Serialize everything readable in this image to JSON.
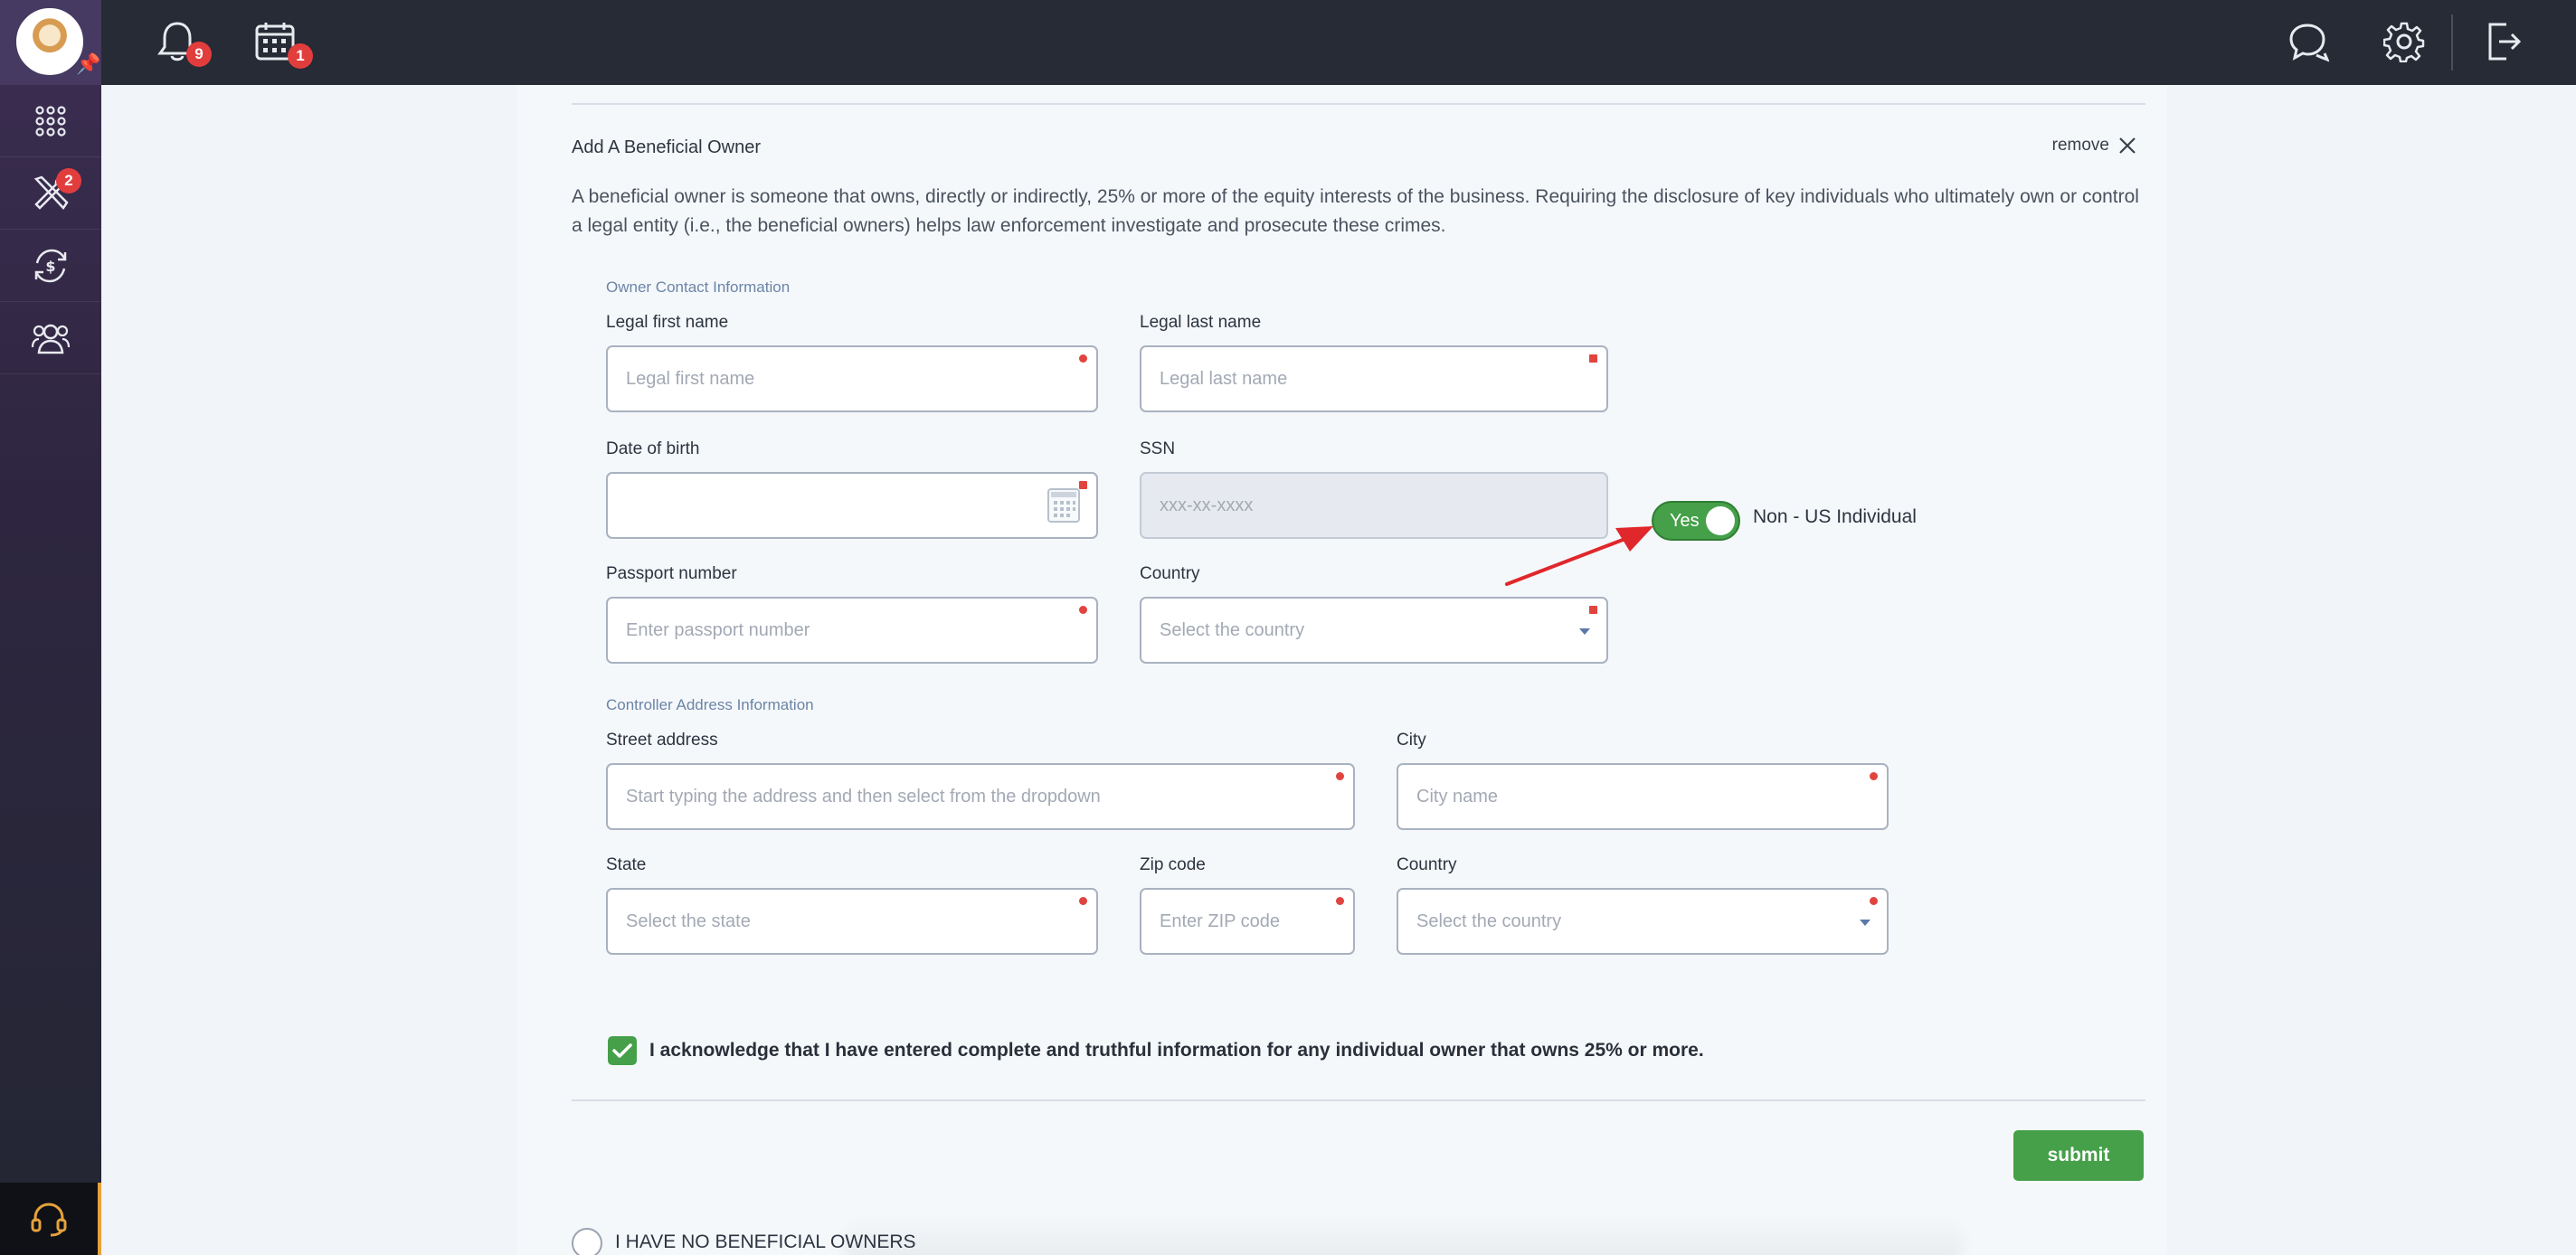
{
  "topbar": {
    "notifications_count": "9",
    "calendar_count": "1"
  },
  "sidebar": {
    "tools_badge": "2"
  },
  "form": {
    "section_title": "Add A Beneficial Owner",
    "remove_label": "remove",
    "description": "A beneficial owner is someone that owns, directly or indirectly, 25% or more of the equity interests of the business. Requiring the disclosure of key individuals who ultimately own or control a legal entity (i.e., the beneficial owners) helps law enforcement investigate and prosecute these crimes.",
    "contact_group": "Owner Contact Information",
    "first_name": {
      "label": "Legal first name",
      "placeholder": "Legal first name",
      "value": ""
    },
    "last_name": {
      "label": "Legal last name",
      "placeholder": "Legal last name",
      "value": ""
    },
    "dob": {
      "label": "Date of birth",
      "value": ""
    },
    "ssn": {
      "label": "SSN",
      "placeholder": "xxx-xx-xxxx"
    },
    "non_us_toggle": {
      "state_label": "Yes",
      "label": "Non - US Individual",
      "on": true
    },
    "passport": {
      "label": "Passport number",
      "placeholder": "Enter passport number"
    },
    "country": {
      "label": "Country",
      "placeholder": "Select the country"
    },
    "address_group": "Controller Address Information",
    "street": {
      "label": "Street address",
      "placeholder": "Start typing the address and then select from the dropdown"
    },
    "city": {
      "label": "City",
      "placeholder": "City name"
    },
    "state": {
      "label": "State",
      "placeholder": "Select the state"
    },
    "zip": {
      "label": "Zip code",
      "placeholder": "Enter ZIP code"
    },
    "address_country": {
      "label": "Country",
      "placeholder": "Select the country"
    },
    "acknowledge": {
      "checked": true,
      "text": "I acknowledge that I have entered complete and truthful information for any individual owner that owns 25% or more."
    },
    "submit_label": "submit"
  },
  "no_owners_option": "I HAVE NO BENEFICIAL OWNERS",
  "colors": {
    "accent_green": "#45a049",
    "required_red": "#e0443f",
    "topbar": "#262b35",
    "annotation_arrow": "#e0272b"
  }
}
